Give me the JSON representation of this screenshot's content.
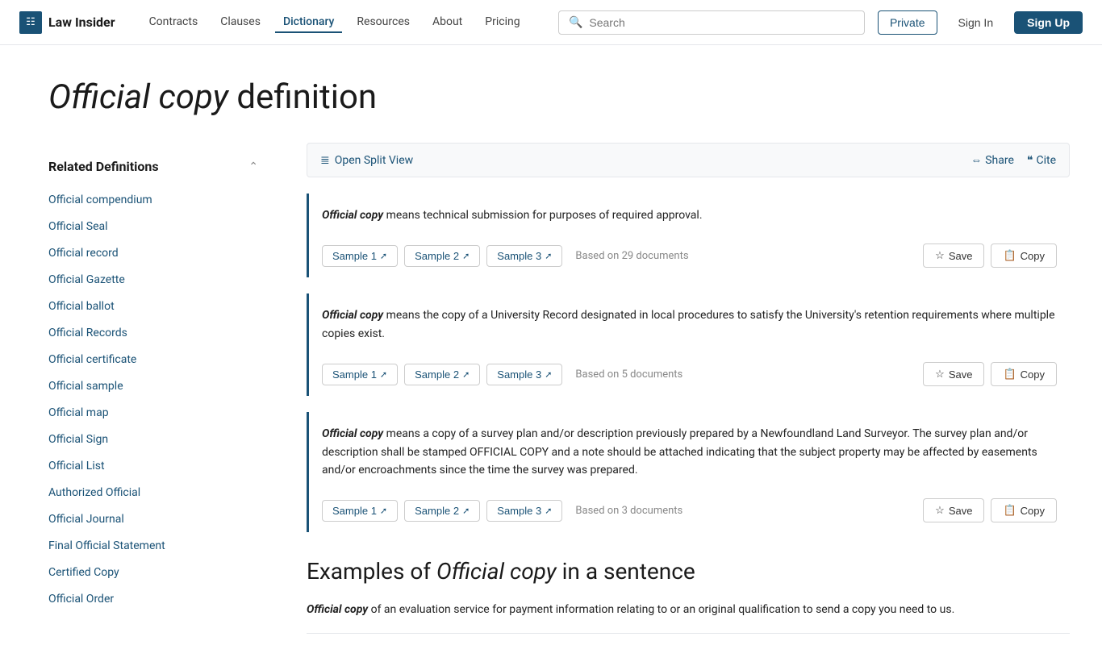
{
  "nav": {
    "logo_text": "Law Insider",
    "logo_icon": "≡",
    "links": [
      {
        "label": "Contracts",
        "active": false
      },
      {
        "label": "Clauses",
        "active": false
      },
      {
        "label": "Dictionary",
        "active": true
      },
      {
        "label": "Resources",
        "active": false
      },
      {
        "label": "About",
        "active": false
      },
      {
        "label": "Pricing",
        "active": false
      }
    ],
    "search_placeholder": "Search",
    "btn_private": "Private",
    "btn_signin": "Sign In",
    "btn_signup": "Sign Up"
  },
  "page": {
    "title_italic": "Official copy",
    "title_normal": " definition"
  },
  "sidebar": {
    "title": "Related Definitions",
    "items": [
      "Official compendium",
      "Official Seal",
      "Official record",
      "Official Gazette",
      "Official ballot",
      "Official Records",
      "Official certificate",
      "Official sample",
      "Official map",
      "Official Sign",
      "Official List",
      "Authorized Official",
      "Official Journal",
      "Final Official Statement",
      "Certified Copy",
      "Official Order"
    ]
  },
  "toolbar": {
    "split_view": "Open Split View",
    "share": "Share",
    "cite": "Cite"
  },
  "definitions": [
    {
      "id": 1,
      "term": "Official copy",
      "text": " means technical submission for purposes of required approval.",
      "samples": [
        "Sample 1",
        "Sample 2",
        "Sample 3"
      ],
      "based_on": "Based on 29 documents",
      "save_label": "Save",
      "copy_label": "Copy"
    },
    {
      "id": 2,
      "term": "Official copy",
      "text": " means the copy of a University Record designated in local procedures to satisfy the University's retention requirements where multiple copies exist.",
      "samples": [
        "Sample 1",
        "Sample 2",
        "Sample 3"
      ],
      "based_on": "Based on 5 documents",
      "save_label": "Save",
      "copy_label": "Copy"
    },
    {
      "id": 3,
      "term": "Official copy",
      "text": " means a copy of a survey plan and/or description previously prepared by a Newfoundland Land Surveyor. The survey plan and/or description shall be stamped OFFICIAL COPY and a note should be attached indicating that the subject property may be affected by easements and/or encroachments since the time the survey was prepared.",
      "samples": [
        "Sample 1",
        "Sample 2",
        "Sample 3"
      ],
      "based_on": "Based on 3 documents",
      "save_label": "Save",
      "copy_label": "Copy"
    }
  ],
  "examples": {
    "title_prefix": "Examples of ",
    "title_term": "Official copy",
    "title_suffix": " in a sentence",
    "items": [
      {
        "term": "Official copy",
        "text": " of an evaluation service for payment information relating to or an original qualification to send a copy you need to us."
      }
    ]
  }
}
